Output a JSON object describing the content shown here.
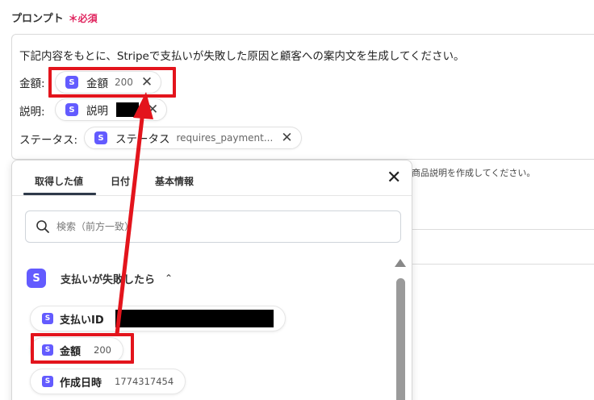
{
  "field": {
    "label": "プロンプト",
    "required_mark": "＊必須"
  },
  "prompt": {
    "text": "下記内容をもとに、Stripeで支払いが失敗した原因と顧客への案内文を生成してください。",
    "rows": [
      {
        "label": "金額:",
        "chip_label": "金額",
        "chip_value": "200"
      },
      {
        "label": "説明:",
        "chip_label": "説明",
        "chip_value": ""
      },
      {
        "label": "ステータス:",
        "chip_label": "ステータス",
        "chip_value": "requires_payment..."
      }
    ],
    "badge": "S"
  },
  "background": {
    "snippet": "商品説明を作成してください。"
  },
  "panel": {
    "tabs": [
      {
        "label": "取得した値",
        "active": true
      },
      {
        "label": "日付",
        "active": false
      },
      {
        "label": "基本情報",
        "active": false
      }
    ],
    "search_placeholder": "検索（前方一致）",
    "group": {
      "badge": "S",
      "title": "支払いが失敗したら",
      "expanded": true
    },
    "items": [
      {
        "label": "支払いID",
        "value": ""
      },
      {
        "label": "金額",
        "value": "200"
      },
      {
        "label": "作成日時",
        "value": "1774317454"
      }
    ]
  },
  "annotation_color": "#e3141c",
  "brand_color": "#635bff",
  "icons": {
    "close": "close-icon",
    "search": "search-icon",
    "chevron": "chevron-up-icon",
    "stripe": "stripe-s-icon"
  }
}
